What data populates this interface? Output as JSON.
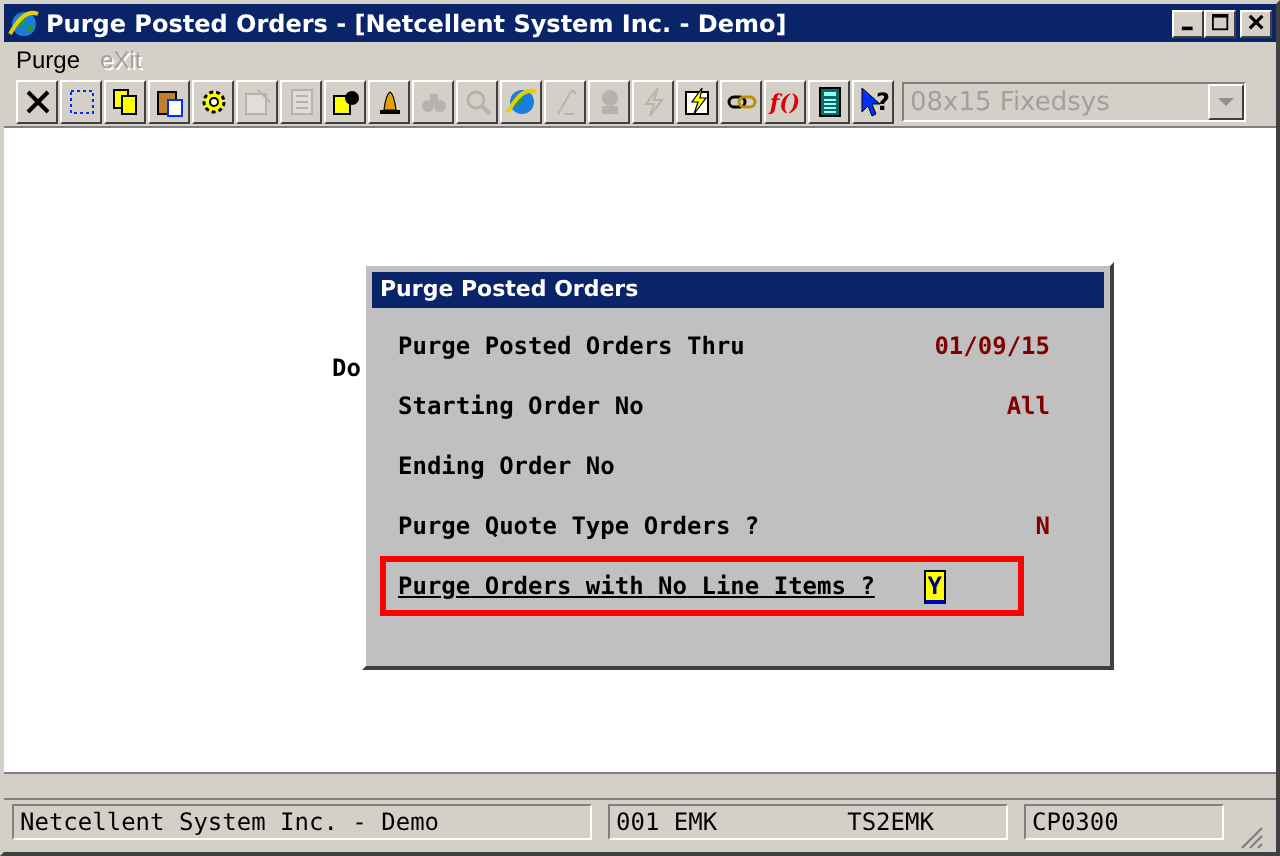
{
  "window": {
    "title": "Purge Posted Orders - [Netcellent System Inc. - Demo]"
  },
  "menu": [
    {
      "label": "Purge",
      "disabled": false
    },
    {
      "label": "eXit",
      "disabled": true
    }
  ],
  "toolbar": [
    {
      "kind": "close",
      "disabled": false
    },
    {
      "kind": "select",
      "disabled": false
    },
    {
      "kind": "copy",
      "disabled": false
    },
    {
      "kind": "paste",
      "disabled": false
    },
    {
      "kind": "gear",
      "disabled": false
    },
    {
      "kind": "properties",
      "disabled": true
    },
    {
      "kind": "document",
      "disabled": true
    },
    {
      "kind": "person",
      "disabled": false
    },
    {
      "kind": "bell",
      "disabled": false
    },
    {
      "kind": "binoculars",
      "disabled": true
    },
    {
      "kind": "magnifier",
      "disabled": true
    },
    {
      "kind": "globe",
      "disabled": false
    },
    {
      "kind": "pen",
      "disabled": true
    },
    {
      "kind": "bust",
      "disabled": true
    },
    {
      "kind": "lightning",
      "disabled": true
    },
    {
      "kind": "lightningdoc",
      "disabled": false
    },
    {
      "kind": "link",
      "disabled": false
    },
    {
      "kind": "function",
      "label": "f()",
      "disabled": false
    },
    {
      "kind": "calculator",
      "disabled": false
    },
    {
      "kind": "help",
      "label": "?",
      "disabled": false
    }
  ],
  "font_select": {
    "value": "08x15 Fixedsys",
    "disabled": true
  },
  "background_text": "Do",
  "dialog": {
    "title": "Purge Posted Orders",
    "fields": [
      {
        "label": "Purge Posted Orders Thru",
        "value": "01/09/15",
        "focused": false,
        "highlighted": false
      },
      {
        "label": "Starting Order No",
        "value": "All",
        "focused": false,
        "highlighted": false
      },
      {
        "label": "Ending Order No",
        "focused": false,
        "highlighted": false
      },
      {
        "label": "Purge Quote Type Orders ?",
        "value": "N",
        "focused": false,
        "highlighted": false
      },
      {
        "label": "Purge Orders with No Line Items ?",
        "value": "Y",
        "focused": true,
        "highlighted": true
      }
    ]
  },
  "status_bar": [
    {
      "text": "Netcellent System Inc. - Demo"
    },
    {
      "text": "001 EMK         TS2EMK"
    },
    {
      "text": "CP0300"
    }
  ]
}
